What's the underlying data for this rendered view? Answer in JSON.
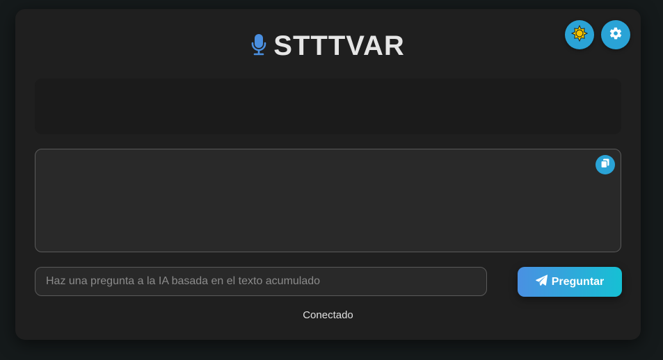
{
  "header": {
    "title": "STTTVAR",
    "mic_icon": "microphone-icon",
    "theme_icon": "sun-icon",
    "settings_icon": "gear-icon"
  },
  "transcript": {
    "live_text": "",
    "accumulated_text": "",
    "copy_icon": "copy-icon"
  },
  "ask": {
    "placeholder": "Haz una pregunta a la IA basada en el texto acumulado",
    "value": "",
    "button_label": "Preguntar",
    "button_icon": "paper-plane-icon"
  },
  "status": {
    "text": "Conectado"
  },
  "colors": {
    "accent": "#2aa3d6",
    "mic": "#4a8fe0",
    "gradient_start": "#4a90e2",
    "gradient_end": "#16c0d4",
    "sun": "#f5d000"
  }
}
